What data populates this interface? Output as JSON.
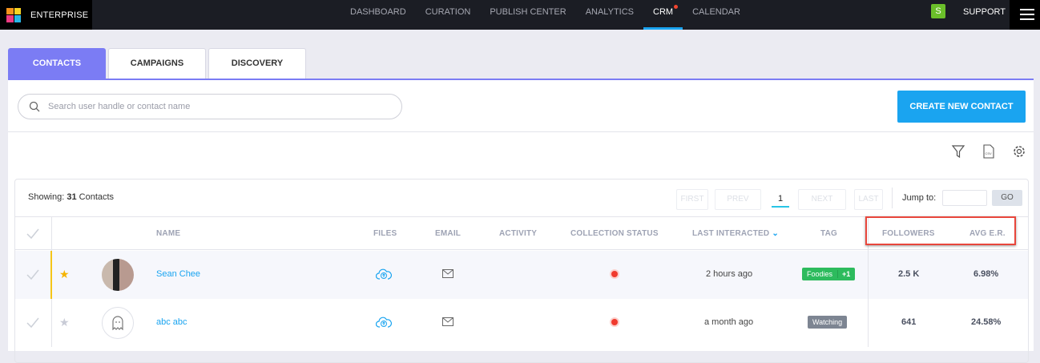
{
  "app": {
    "brand": "ENTERPRISE",
    "nav": [
      "DASHBOARD",
      "CURATION",
      "PUBLISH CENTER",
      "ANALYTICS",
      "CRM",
      "CALENDAR"
    ],
    "active_nav": "CRM",
    "user_initial": "S",
    "support": "SUPPORT"
  },
  "tabs": [
    "CONTACTS",
    "CAMPAIGNS",
    "DISCOVERY"
  ],
  "search": {
    "placeholder": "Search user handle or contact name"
  },
  "create_button": "CREATE NEW CONTACT",
  "toolbar_icons": [
    "filter-icon",
    "csv-icon",
    "gear-icon"
  ],
  "showing": {
    "label": "Showing:",
    "count": "31",
    "unit": "Contacts"
  },
  "pagination": {
    "first": "FIRST",
    "prev": "PREV",
    "page": "1",
    "next": "NEXT",
    "last": "LAST",
    "jump_label": "Jump to:",
    "go": "GO"
  },
  "columns": [
    "NAME",
    "FILES",
    "EMAIL",
    "ACTIVITY",
    "COLLECTION STATUS",
    "LAST INTERACTED",
    "TAG",
    "FOLLOWERS",
    "AVG E.R."
  ],
  "rows": [
    {
      "name": "Sean Chee",
      "starred": true,
      "last_interacted": "2 hours ago",
      "tag": "Foodies",
      "tag_extra": "+1",
      "tag_color": "#2dbb5d",
      "followers": "2.5 K",
      "avg_er": "6.98%"
    },
    {
      "name": "abc abc",
      "starred": false,
      "last_interacted": "a month ago",
      "tag": "Watching",
      "tag_color": "#7d8592",
      "followers": "641",
      "avg_er": "24.58%"
    }
  ],
  "colors": {
    "accent": "#7b7cf4",
    "primary": "#1aa4f0",
    "highlight": "#e8463c"
  }
}
